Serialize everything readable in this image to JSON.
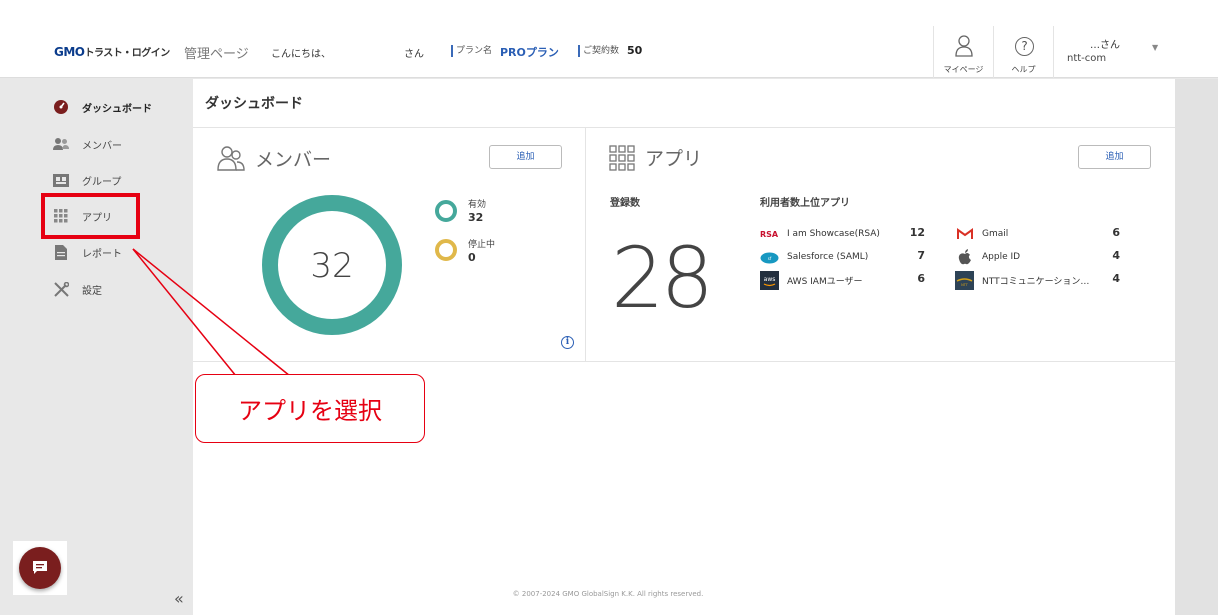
{
  "header": {
    "logo_gmo": "GMO",
    "logo_rest": "トラスト・ログイン",
    "admin_title": "管理ページ",
    "greeting": "こんにちは、",
    "user_suffix": "さん",
    "plan_label": "プラン名",
    "plan_value": "PROプラン",
    "contract_label": "ご契約数",
    "contract_value": "50",
    "mypage_label": "マイページ",
    "help_label": "ヘルプ",
    "help_glyph": "?",
    "account_name": "…さん",
    "account_org": "ntt-com"
  },
  "sidebar": {
    "items": [
      {
        "label": "ダッシュボード",
        "icon": "dashboard-icon"
      },
      {
        "label": "メンバー",
        "icon": "members-icon"
      },
      {
        "label": "グループ",
        "icon": "group-icon"
      },
      {
        "label": "アプリ",
        "icon": "apps-grid-icon"
      },
      {
        "label": "レポート",
        "icon": "report-icon"
      },
      {
        "label": "設定",
        "icon": "settings-tools-icon"
      }
    ],
    "collapse_glyph": "«"
  },
  "main": {
    "page_title": "ダッシュボード",
    "members_card": {
      "title": "メンバー",
      "add_label": "追加",
      "total": "32",
      "legend": [
        {
          "label": "有効",
          "value": "32",
          "color": "#45a89b"
        },
        {
          "label": "停止中",
          "value": "0",
          "color": "#e0b84a"
        }
      ],
      "info_glyph": "i"
    },
    "apps_card": {
      "title": "アプリ",
      "add_label": "追加",
      "registered_label": "登録数",
      "registered_count": "28",
      "top_apps_label": "利用者数上位アプリ",
      "top_apps": [
        {
          "name": "I am Showcase(RSA)",
          "count": "12",
          "icon": "rsa-icon"
        },
        {
          "name": "Salesforce (SAML)",
          "count": "7",
          "icon": "salesforce-icon"
        },
        {
          "name": "AWS IAMユーザー",
          "count": "6",
          "icon": "aws-icon"
        },
        {
          "name": "Gmail",
          "count": "6",
          "icon": "gmail-icon"
        },
        {
          "name": "Apple ID",
          "count": "4",
          "icon": "apple-icon"
        },
        {
          "name": "NTTコミュニケーション…",
          "count": "4",
          "icon": "ntt-icon"
        }
      ]
    },
    "footer": "© 2007-2024 GMO GlobalSign K.K. All rights reserved."
  },
  "annotation": {
    "callout_text": "アプリを選択",
    "color": "#e60012"
  }
}
